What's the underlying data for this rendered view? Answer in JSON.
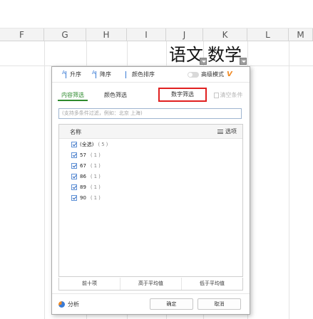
{
  "columns": [
    "F",
    "G",
    "H",
    "I",
    "J",
    "K",
    "L",
    "M"
  ],
  "cells": {
    "chinese": "语文",
    "math": "数学"
  },
  "toolbar": {
    "asc_icon_text": "A",
    "asc": "升序",
    "desc_icon_text": "A",
    "desc": "降序",
    "color_sort": "颜色排序",
    "advanced": "高级模式",
    "v_badge": "V"
  },
  "tabs": {
    "content": "内容筛选",
    "color": "颜色筛选",
    "number": "数字筛选",
    "clear": "清空条件"
  },
  "search": {
    "placeholder": "(支持多条件过滤，例如：北京 上海)"
  },
  "list": {
    "header_name": "名称",
    "header_options": "选项",
    "items": [
      {
        "label": "(全选)",
        "count": "(5)"
      },
      {
        "label": "57",
        "count": "(1)"
      },
      {
        "label": "67",
        "count": "(1)"
      },
      {
        "label": "86",
        "count": "(1)"
      },
      {
        "label": "89",
        "count": "(1)"
      },
      {
        "label": "90",
        "count": "(1)"
      }
    ]
  },
  "bottom_buttons": {
    "top10": "前十项",
    "above_avg": "高于平均值",
    "below_avg": "低于平均值"
  },
  "footer": {
    "analyze": "分析",
    "ok": "确定",
    "cancel": "取消"
  },
  "colors": {
    "accent_green": "#2e8b2e",
    "highlight_red": "#e02020",
    "link_blue": "#3a7bd5"
  }
}
